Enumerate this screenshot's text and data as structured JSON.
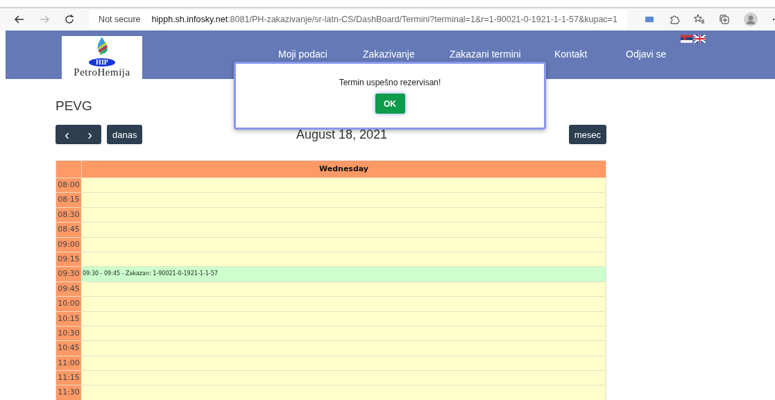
{
  "browser": {
    "security": "Not secure",
    "url_host": "hipph.sh.infosky.net",
    "url_rest": ":8081/PH-zakazivanje/sr-latn-CS/DashBoard/Termini?terminal=1&r=1-90021-0-1921-1-1-57&kupac=1"
  },
  "logo": {
    "badge": "HIP",
    "name": "PetroHemija"
  },
  "nav": [
    "Moji podaci",
    "Zakazivanje",
    "Zakazani termini",
    "Kontakt",
    "Odjavi se"
  ],
  "title": "PEVG",
  "toolbar": {
    "prev": "‹",
    "next": "›",
    "today": "danas",
    "date": "August 18, 2021",
    "month": "mesec"
  },
  "calendar": {
    "day": "Wednesday",
    "rows": [
      {
        "time": "08:00",
        "booked": false
      },
      {
        "time": "08:15",
        "booked": false
      },
      {
        "time": "08:30",
        "booked": false
      },
      {
        "time": "08:45",
        "booked": false
      },
      {
        "time": "09:00",
        "booked": false
      },
      {
        "time": "09:15",
        "booked": false
      },
      {
        "time": "09:30",
        "booked": true,
        "event": "09:30 - 09:45 - Zakazan: 1-90021-0-1921-1-1-57"
      },
      {
        "time": "09:45",
        "booked": false
      },
      {
        "time": "10:00",
        "booked": false
      },
      {
        "time": "10:15",
        "booked": false
      },
      {
        "time": "10:30",
        "booked": false
      },
      {
        "time": "10:45",
        "booked": false
      },
      {
        "time": "11:00",
        "booked": false
      },
      {
        "time": "11:15",
        "booked": false
      },
      {
        "time": "11:30",
        "booked": false
      }
    ]
  },
  "dialog": {
    "message": "Termin uspešno rezervisan!",
    "button": "OK"
  }
}
